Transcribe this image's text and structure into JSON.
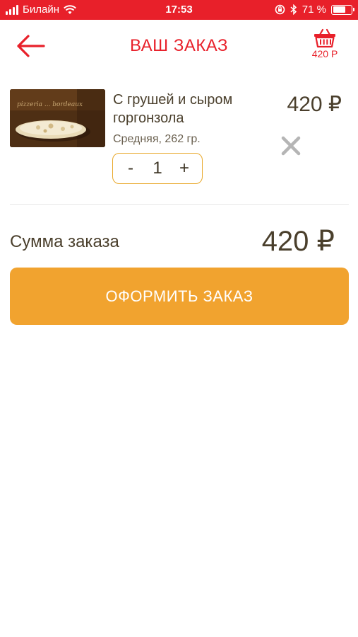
{
  "status_bar": {
    "carrier": "Билайн",
    "time": "17:53",
    "battery_percent": "71 %",
    "battery_level": 0.71
  },
  "header": {
    "title": "ВАШ ЗАКАЗ",
    "cart_total": "420 Р",
    "back_icon": "arrow-left-icon",
    "cart_icon": "basket-icon"
  },
  "order": {
    "items": [
      {
        "name": "С грушей и сыром горгонзола",
        "size": "Средняя, 262 гр.",
        "quantity": "1",
        "price": "420 ₽",
        "image_text": "pizzeria ... bordeaux"
      }
    ],
    "stepper": {
      "minus": "-",
      "plus": "+"
    }
  },
  "summary": {
    "label": "Сумма заказа",
    "total": "420 ₽"
  },
  "checkout_button": "ОФОРМИТЬ ЗАКАЗ",
  "colors": {
    "brand_red": "#e8202a",
    "accent_orange": "#f1a32f",
    "text_dark": "#4a3f2c"
  }
}
